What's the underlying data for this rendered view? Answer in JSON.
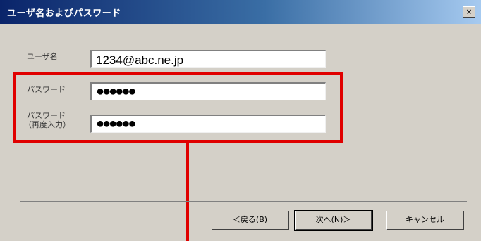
{
  "window": {
    "title": "ユーザ名およびパスワード",
    "close_label": "×"
  },
  "form": {
    "username_label": "ユーザ名",
    "username_value": "1234@abc.ne.jp",
    "password_label": "パスワード",
    "password_value": "●●●●●●",
    "password_confirm_label_line1": "パスワード",
    "password_confirm_label_line2": "（再度入力）",
    "password_confirm_value": "●●●●●●"
  },
  "buttons": {
    "back": "＜戻る(B)",
    "next": "次へ(N)＞",
    "cancel": "キャンセル"
  },
  "colors": {
    "highlight": "#e00000",
    "titlebar_start": "#0a246a",
    "dialog_bg": "#d4d0c8"
  }
}
